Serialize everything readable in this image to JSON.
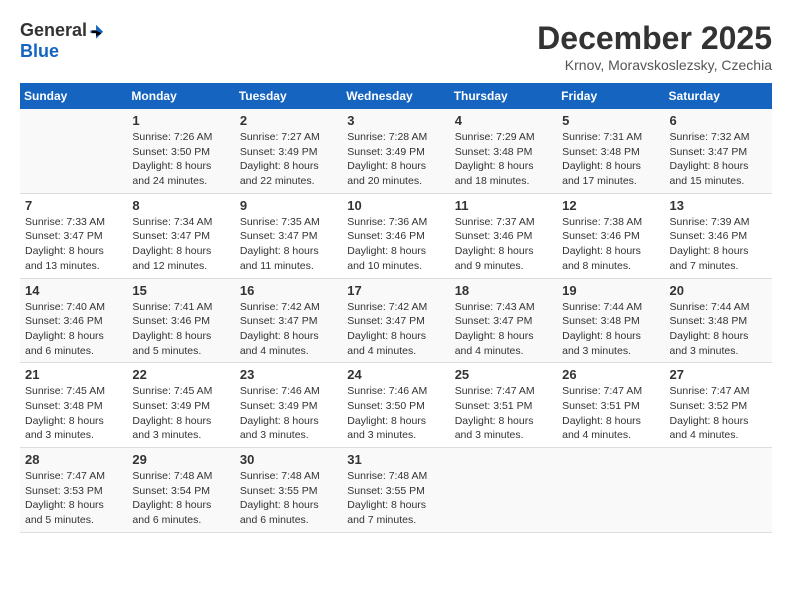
{
  "header": {
    "logo_general": "General",
    "logo_blue": "Blue",
    "month_title": "December 2025",
    "location": "Krnov, Moravskoslezsky, Czechia"
  },
  "calendar": {
    "weekdays": [
      "Sunday",
      "Monday",
      "Tuesday",
      "Wednesday",
      "Thursday",
      "Friday",
      "Saturday"
    ],
    "weeks": [
      [
        {
          "day": "",
          "sunrise": "",
          "sunset": "",
          "daylight": ""
        },
        {
          "day": "1",
          "sunrise": "Sunrise: 7:26 AM",
          "sunset": "Sunset: 3:50 PM",
          "daylight": "Daylight: 8 hours and 24 minutes."
        },
        {
          "day": "2",
          "sunrise": "Sunrise: 7:27 AM",
          "sunset": "Sunset: 3:49 PM",
          "daylight": "Daylight: 8 hours and 22 minutes."
        },
        {
          "day": "3",
          "sunrise": "Sunrise: 7:28 AM",
          "sunset": "Sunset: 3:49 PM",
          "daylight": "Daylight: 8 hours and 20 minutes."
        },
        {
          "day": "4",
          "sunrise": "Sunrise: 7:29 AM",
          "sunset": "Sunset: 3:48 PM",
          "daylight": "Daylight: 8 hours and 18 minutes."
        },
        {
          "day": "5",
          "sunrise": "Sunrise: 7:31 AM",
          "sunset": "Sunset: 3:48 PM",
          "daylight": "Daylight: 8 hours and 17 minutes."
        },
        {
          "day": "6",
          "sunrise": "Sunrise: 7:32 AM",
          "sunset": "Sunset: 3:47 PM",
          "daylight": "Daylight: 8 hours and 15 minutes."
        }
      ],
      [
        {
          "day": "7",
          "sunrise": "Sunrise: 7:33 AM",
          "sunset": "Sunset: 3:47 PM",
          "daylight": "Daylight: 8 hours and 13 minutes."
        },
        {
          "day": "8",
          "sunrise": "Sunrise: 7:34 AM",
          "sunset": "Sunset: 3:47 PM",
          "daylight": "Daylight: 8 hours and 12 minutes."
        },
        {
          "day": "9",
          "sunrise": "Sunrise: 7:35 AM",
          "sunset": "Sunset: 3:47 PM",
          "daylight": "Daylight: 8 hours and 11 minutes."
        },
        {
          "day": "10",
          "sunrise": "Sunrise: 7:36 AM",
          "sunset": "Sunset: 3:46 PM",
          "daylight": "Daylight: 8 hours and 10 minutes."
        },
        {
          "day": "11",
          "sunrise": "Sunrise: 7:37 AM",
          "sunset": "Sunset: 3:46 PM",
          "daylight": "Daylight: 8 hours and 9 minutes."
        },
        {
          "day": "12",
          "sunrise": "Sunrise: 7:38 AM",
          "sunset": "Sunset: 3:46 PM",
          "daylight": "Daylight: 8 hours and 8 minutes."
        },
        {
          "day": "13",
          "sunrise": "Sunrise: 7:39 AM",
          "sunset": "Sunset: 3:46 PM",
          "daylight": "Daylight: 8 hours and 7 minutes."
        }
      ],
      [
        {
          "day": "14",
          "sunrise": "Sunrise: 7:40 AM",
          "sunset": "Sunset: 3:46 PM",
          "daylight": "Daylight: 8 hours and 6 minutes."
        },
        {
          "day": "15",
          "sunrise": "Sunrise: 7:41 AM",
          "sunset": "Sunset: 3:46 PM",
          "daylight": "Daylight: 8 hours and 5 minutes."
        },
        {
          "day": "16",
          "sunrise": "Sunrise: 7:42 AM",
          "sunset": "Sunset: 3:47 PM",
          "daylight": "Daylight: 8 hours and 4 minutes."
        },
        {
          "day": "17",
          "sunrise": "Sunrise: 7:42 AM",
          "sunset": "Sunset: 3:47 PM",
          "daylight": "Daylight: 8 hours and 4 minutes."
        },
        {
          "day": "18",
          "sunrise": "Sunrise: 7:43 AM",
          "sunset": "Sunset: 3:47 PM",
          "daylight": "Daylight: 8 hours and 4 minutes."
        },
        {
          "day": "19",
          "sunrise": "Sunrise: 7:44 AM",
          "sunset": "Sunset: 3:48 PM",
          "daylight": "Daylight: 8 hours and 3 minutes."
        },
        {
          "day": "20",
          "sunrise": "Sunrise: 7:44 AM",
          "sunset": "Sunset: 3:48 PM",
          "daylight": "Daylight: 8 hours and 3 minutes."
        }
      ],
      [
        {
          "day": "21",
          "sunrise": "Sunrise: 7:45 AM",
          "sunset": "Sunset: 3:48 PM",
          "daylight": "Daylight: 8 hours and 3 minutes."
        },
        {
          "day": "22",
          "sunrise": "Sunrise: 7:45 AM",
          "sunset": "Sunset: 3:49 PM",
          "daylight": "Daylight: 8 hours and 3 minutes."
        },
        {
          "day": "23",
          "sunrise": "Sunrise: 7:46 AM",
          "sunset": "Sunset: 3:49 PM",
          "daylight": "Daylight: 8 hours and 3 minutes."
        },
        {
          "day": "24",
          "sunrise": "Sunrise: 7:46 AM",
          "sunset": "Sunset: 3:50 PM",
          "daylight": "Daylight: 8 hours and 3 minutes."
        },
        {
          "day": "25",
          "sunrise": "Sunrise: 7:47 AM",
          "sunset": "Sunset: 3:51 PM",
          "daylight": "Daylight: 8 hours and 3 minutes."
        },
        {
          "day": "26",
          "sunrise": "Sunrise: 7:47 AM",
          "sunset": "Sunset: 3:51 PM",
          "daylight": "Daylight: 8 hours and 4 minutes."
        },
        {
          "day": "27",
          "sunrise": "Sunrise: 7:47 AM",
          "sunset": "Sunset: 3:52 PM",
          "daylight": "Daylight: 8 hours and 4 minutes."
        }
      ],
      [
        {
          "day": "28",
          "sunrise": "Sunrise: 7:47 AM",
          "sunset": "Sunset: 3:53 PM",
          "daylight": "Daylight: 8 hours and 5 minutes."
        },
        {
          "day": "29",
          "sunrise": "Sunrise: 7:48 AM",
          "sunset": "Sunset: 3:54 PM",
          "daylight": "Daylight: 8 hours and 6 minutes."
        },
        {
          "day": "30",
          "sunrise": "Sunrise: 7:48 AM",
          "sunset": "Sunset: 3:55 PM",
          "daylight": "Daylight: 8 hours and 6 minutes."
        },
        {
          "day": "31",
          "sunrise": "Sunrise: 7:48 AM",
          "sunset": "Sunset: 3:55 PM",
          "daylight": "Daylight: 8 hours and 7 minutes."
        },
        {
          "day": "",
          "sunrise": "",
          "sunset": "",
          "daylight": ""
        },
        {
          "day": "",
          "sunrise": "",
          "sunset": "",
          "daylight": ""
        },
        {
          "day": "",
          "sunrise": "",
          "sunset": "",
          "daylight": ""
        }
      ]
    ]
  }
}
